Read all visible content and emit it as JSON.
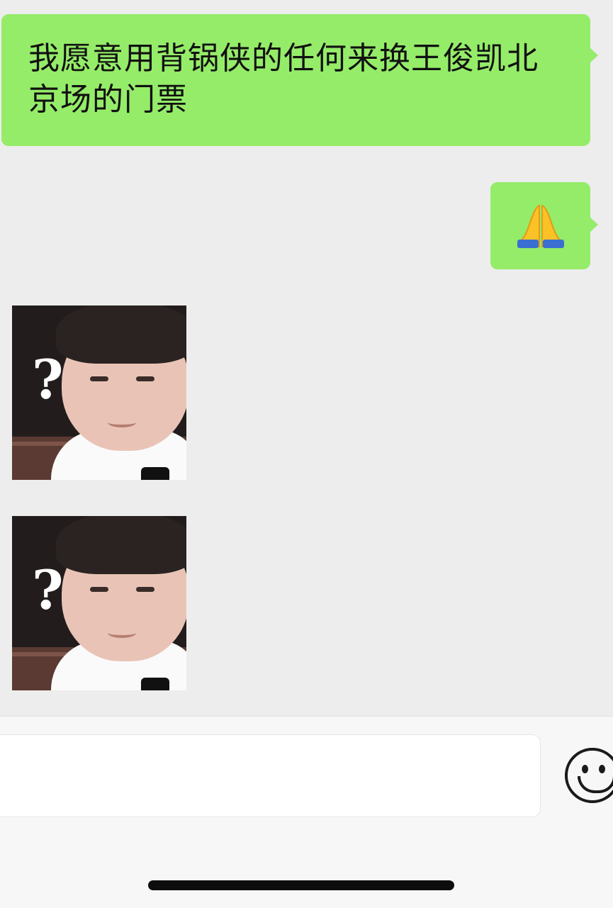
{
  "messages": [
    {
      "sender": "self",
      "type": "text",
      "text": "我愿意用背锅侠的任何来换王俊凯北京场的门票"
    },
    {
      "sender": "self",
      "type": "emoji",
      "text": "🙏"
    },
    {
      "sender": "other",
      "type": "sticker",
      "sticker": "confused-child-question-mark",
      "caption": "?"
    },
    {
      "sender": "other",
      "type": "sticker",
      "sticker": "confused-child-question-mark",
      "caption": "?"
    }
  ],
  "input_bar": {
    "message_value": "",
    "emoji_button_icon": "smiley-face-icon"
  },
  "colors": {
    "chat_background": "#ededed",
    "self_bubble": "#95ec69",
    "input_bar_background": "#f7f7f7"
  }
}
